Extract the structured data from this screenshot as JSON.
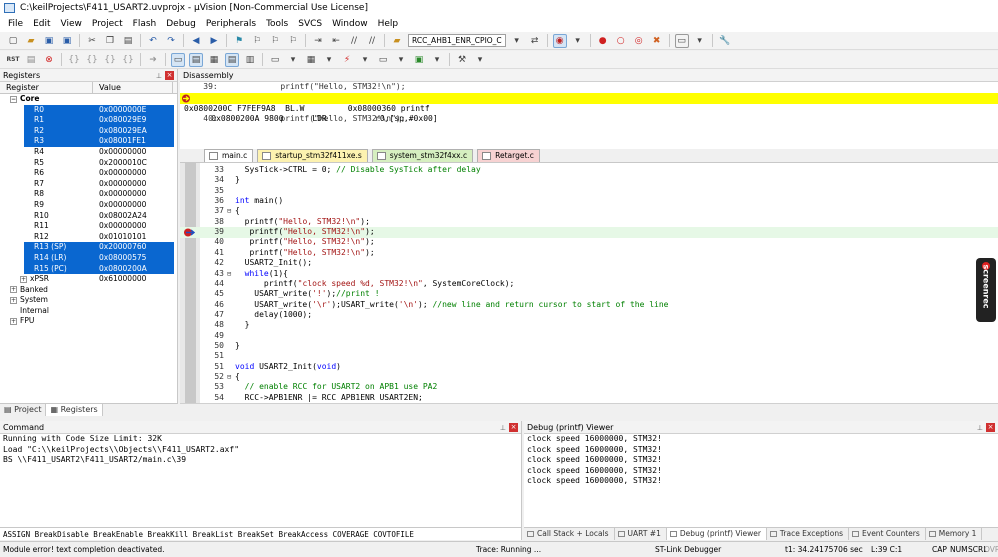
{
  "window": {
    "title": "C:\\keilProjects\\F411_USART2.uvprojx - µVision  [Non-Commercial Use License]"
  },
  "menu": [
    "File",
    "Edit",
    "View",
    "Project",
    "Flash",
    "Debug",
    "Peripherals",
    "Tools",
    "SVCS",
    "Window",
    "Help"
  ],
  "toolbar": {
    "target_combo": "RCC_AHB1_ENR_CPIO_C"
  },
  "registers": {
    "title": "Registers",
    "col_register": "Register",
    "col_value": "Value",
    "group_core": "Core",
    "rows": [
      {
        "name": "R0",
        "value": "0x0000000E",
        "selected": true
      },
      {
        "name": "R1",
        "value": "0x080029E9",
        "selected": true
      },
      {
        "name": "R2",
        "value": "0x080029EA",
        "selected": true
      },
      {
        "name": "R3",
        "value": "0x08001FE1",
        "selected": true
      },
      {
        "name": "R4",
        "value": "0x00000000",
        "selected": false
      },
      {
        "name": "R5",
        "value": "0x2000010C",
        "selected": false
      },
      {
        "name": "R6",
        "value": "0x00000000",
        "selected": false
      },
      {
        "name": "R7",
        "value": "0x00000000",
        "selected": false
      },
      {
        "name": "R8",
        "value": "0x00000000",
        "selected": false
      },
      {
        "name": "R9",
        "value": "0x00000000",
        "selected": false
      },
      {
        "name": "R10",
        "value": "0x08002A24",
        "selected": false
      },
      {
        "name": "R11",
        "value": "0x00000000",
        "selected": false
      },
      {
        "name": "R12",
        "value": "0x01010101",
        "selected": false
      },
      {
        "name": "R13 (SP)",
        "value": "0x20000760",
        "selected": true
      },
      {
        "name": "R14 (LR)",
        "value": "0x08000575",
        "selected": true
      },
      {
        "name": "R15 (PC)",
        "value": "0x0800200A",
        "selected": true
      }
    ],
    "xpsr": {
      "name": "xPSR",
      "value": "0x61000000"
    },
    "groups": [
      "Banked",
      "System",
      "Internal",
      "FPU"
    ],
    "tab_project": "Project",
    "tab_registers": "Registers"
  },
  "disassembly": {
    "title": "Disassembly",
    "lines": [
      "    39:             printf(\"Hello, STM32!\\n\");",
      "0x0800200A 9800      LDR          r0,[sp,#0x00]",
      "0x0800200C F7FEF9A8  BL.W         0x08000360 printf",
      "    40:             printf(\"Hello, STM32!\\n\");"
    ]
  },
  "editor": {
    "tabs": [
      {
        "name": "main.c",
        "color": "#ffffff"
      },
      {
        "name": "startup_stm32f411xe.s",
        "color": "#fdf2b0"
      },
      {
        "name": "system_stm32f4xx.c",
        "color": "#d6efc0"
      },
      {
        "name": "Retarget.c",
        "color": "#f7d2d2"
      }
    ],
    "lines": [
      {
        "num": "33",
        "fold": "",
        "html": "  SysTick-&gt;CTRL = 0; <span class=\"cmt\">// Disable SysTick after delay</span>"
      },
      {
        "num": "34",
        "fold": "",
        "html": "}"
      },
      {
        "num": "35",
        "fold": "",
        "html": ""
      },
      {
        "num": "36",
        "fold": "",
        "html": "<span class=\"kw\">int</span> main()"
      },
      {
        "num": "37",
        "fold": "⊟",
        "html": "{"
      },
      {
        "num": "38",
        "fold": "",
        "html": "  printf(<span class=\"str\">\"Hello, STM32!\\n\"</span>);"
      },
      {
        "num": "39",
        "fold": "",
        "html": "   printf(<span class=\"str\">\"Hello, STM32!\\n\"</span>);",
        "hl": true
      },
      {
        "num": "40",
        "fold": "",
        "html": "   printf(<span class=\"str\">\"Hello, STM32!\\n\"</span>);"
      },
      {
        "num": "41",
        "fold": "",
        "html": "   printf(<span class=\"str\">\"Hello, STM32!\\n\"</span>);"
      },
      {
        "num": "42",
        "fold": "",
        "html": "  USART2_Init();"
      },
      {
        "num": "43",
        "fold": "⊟",
        "html": "  <span class=\"kw\">while</span>(1){"
      },
      {
        "num": "44",
        "fold": "",
        "html": "      printf(<span class=\"str\">\"clock speed %d, STM32!\\n\"</span>, SystemCoreClock);"
      },
      {
        "num": "45",
        "fold": "",
        "html": "    USART_write(<span class=\"str\">'!'</span>);<span class=\"cmt\">//print !</span>"
      },
      {
        "num": "46",
        "fold": "",
        "html": "    USART_write(<span class=\"str\">'\\r'</span>);USART_write(<span class=\"str\">'\\n'</span>); <span class=\"cmt\">//new line and return cursor to start of the line</span>"
      },
      {
        "num": "47",
        "fold": "",
        "html": "    delay(1000);"
      },
      {
        "num": "48",
        "fold": "",
        "html": "  }"
      },
      {
        "num": "49",
        "fold": "",
        "html": ""
      },
      {
        "num": "50",
        "fold": "",
        "html": "}"
      },
      {
        "num": "51",
        "fold": "",
        "html": ""
      },
      {
        "num": "51",
        "fold": "",
        "html": "<span class=\"kw\">void</span> USART2_Init(<span class=\"kw\">void</span>)"
      },
      {
        "num": "52",
        "fold": "⊟",
        "html": "{"
      },
      {
        "num": "53",
        "fold": "",
        "html": "  <span class=\"cmt\">// enable RCC for USART2 on APB1 use PA2</span>"
      },
      {
        "num": "54",
        "fold": "",
        "html": "  RCC-&gt;APB1ENR |= RCC APB1ENR USART2EN;"
      }
    ]
  },
  "watermark": "screenrec",
  "command": {
    "title": "Command",
    "lines": [
      "Running with Code Size Limit: 32K",
      "Load \"C:\\\\keilProjects\\\\Objects\\\\F411_USART2.axf\"",
      "BS \\\\F411_USART2\\F411_USART2/main.c\\39"
    ],
    "input_hint": "ASSIGN BreakDisable BreakEnable BreakKill BreakList BreakSet BreakAccess COVERAGE COVTOFILE"
  },
  "debug_viewer": {
    "title": "Debug (printf) Viewer",
    "lines": [
      "clock speed 16000000, STM32!",
      "clock speed 16000000, STM32!",
      "clock speed 16000000, STM32!",
      "clock speed 16000000, STM32!",
      "clock speed 16000000, STM32!"
    ],
    "tabs": [
      "Call Stack + Locals",
      "UART #1",
      "Debug (printf) Viewer",
      "Trace Exceptions",
      "Event Counters",
      "Memory 1"
    ]
  },
  "status": {
    "message": "Module error! text completion deactivated.",
    "trace": "Trace: Running ...",
    "debugger": "ST-Link Debugger",
    "time": "t1: 34.24175706 sec",
    "position": "L:39 C:1",
    "cap": "CAP",
    "num": "NUM",
    "scrl": "SCRL",
    "ovr": "OVR",
    "rw": "R/W"
  }
}
